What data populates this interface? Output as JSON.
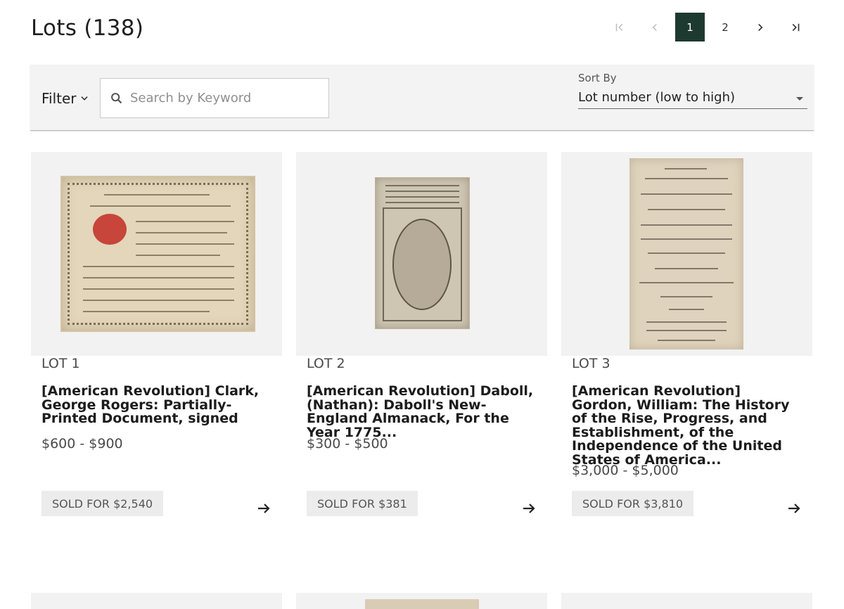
{
  "header": {
    "title": "Lots (138)"
  },
  "pagination": {
    "pages": [
      "1",
      "2"
    ],
    "current": "1"
  },
  "filterbar": {
    "filter_label": "Filter",
    "search_placeholder": "Search by Keyword",
    "sort_label": "Sort By",
    "sort_value": "Lot number (low to high)"
  },
  "lots": [
    {
      "lot": "LOT 1",
      "title": "[American Revolution] Clark, George Rogers: Partially-Printed Document, signed",
      "estimate": "$600 - $900",
      "sold": "SOLD FOR $2,540"
    },
    {
      "lot": "LOT 2",
      "title": "[American Revolution] Daboll, (Nathan): Daboll's New-England Almanack, For the Year 1775...",
      "estimate": "$300 - $500",
      "sold": "SOLD FOR $381"
    },
    {
      "lot": "LOT 3",
      "title": "[American Revolution] Gordon, William: The History of the Rise, Progress, and Establishment, of the Independence of the United States of America...",
      "estimate": "$3,000 - $5,000",
      "sold": "SOLD FOR $3,810"
    }
  ],
  "colors": {
    "accent": "#1e3a30",
    "panel": "#f3f3f3",
    "badge": "#ececec"
  }
}
